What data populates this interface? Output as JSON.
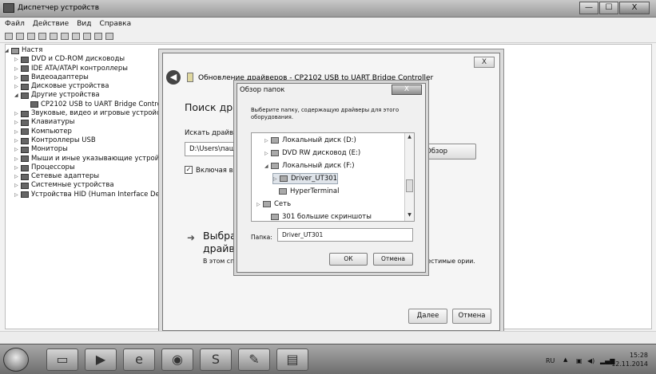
{
  "window": {
    "title": "Диспетчер устройств",
    "buttons": [
      "—",
      "☐",
      "X"
    ]
  },
  "menu": [
    "Файл",
    "Действие",
    "Вид",
    "Справка"
  ],
  "tree": [
    {
      "label": "Настя",
      "expander": "◢",
      "indent": 0
    },
    {
      "label": "DVD и CD-ROM дисководы",
      "expander": "▷",
      "indent": 1
    },
    {
      "label": "IDE ATA/ATAPI контроллеры",
      "expander": "▷",
      "indent": 1
    },
    {
      "label": "Видеоадаптеры",
      "expander": "▷",
      "indent": 1
    },
    {
      "label": "Дисковые устройства",
      "expander": "▷",
      "indent": 1
    },
    {
      "label": "Другие устройства",
      "expander": "◢",
      "indent": 1
    },
    {
      "label": "CP2102 USB to UART Bridge Contro",
      "expander": "",
      "indent": 2
    },
    {
      "label": "Звуковые, видео и игровые устройст",
      "expander": "▷",
      "indent": 1
    },
    {
      "label": "Клавиатуры",
      "expander": "▷",
      "indent": 1
    },
    {
      "label": "Компьютер",
      "expander": "▷",
      "indent": 1
    },
    {
      "label": "Контроллеры USB",
      "expander": "▷",
      "indent": 1
    },
    {
      "label": "Мониторы",
      "expander": "▷",
      "indent": 1
    },
    {
      "label": "Мыши и иные указывающие устройс",
      "expander": "▷",
      "indent": 1
    },
    {
      "label": "Процессоры",
      "expander": "▷",
      "indent": 1
    },
    {
      "label": "Сетевые адаптеры",
      "expander": "▷",
      "indent": 1
    },
    {
      "label": "Системные устройства",
      "expander": "▷",
      "indent": 1
    },
    {
      "label": "Устройства HID (Human Interface Dev",
      "expander": "▷",
      "indent": 1
    }
  ],
  "update_dialog": {
    "close": "X",
    "back": "◀",
    "header": "Обновление драйверов - CP2102 USB to UART Bridge Controller",
    "heading": "Поиск драйв",
    "search_label": "Искать драйвер",
    "path_value": "D:\\Users\\паша\\",
    "browse_label": "Обзор",
    "include_check": "✓",
    "include_label": "Включая влож",
    "option_arrow": "➜",
    "option_title": "Выбрать драйвер",
    "option_desc_left": "В этом спи с этим устр",
    "option_desc_right": "вместимые ории.",
    "next_button": "Далее",
    "cancel_button": "Отмена"
  },
  "browse_dialog": {
    "title": "Обзор папок",
    "close": "X",
    "instructions": "Выберите папку, содержащую драйверы для этого оборудования.",
    "items": [
      {
        "label": "Локальный диск (D:)",
        "tri": "▷",
        "indent": 1
      },
      {
        "label": "DVD RW дисковод (E:)",
        "tri": "▷",
        "indent": 1
      },
      {
        "label": "Локальный диск (F:)",
        "tri": "◢",
        "indent": 1
      },
      {
        "label": "Driver_UT301",
        "tri": "▷",
        "indent": 2,
        "selected": true
      },
      {
        "label": "HyperTerminal",
        "tri": "",
        "indent": 2
      },
      {
        "label": "Сеть",
        "tri": "▷",
        "indent": 0
      },
      {
        "label": "301 большие скриншоты",
        "tri": "",
        "indent": 1
      }
    ],
    "folder_label": "Папка:",
    "folder_value": "Driver_UT301",
    "ok": "ОК",
    "cancel": "Отмена"
  },
  "tray": {
    "lang": "RU",
    "time": "15:28",
    "date": "12.11.2014"
  }
}
